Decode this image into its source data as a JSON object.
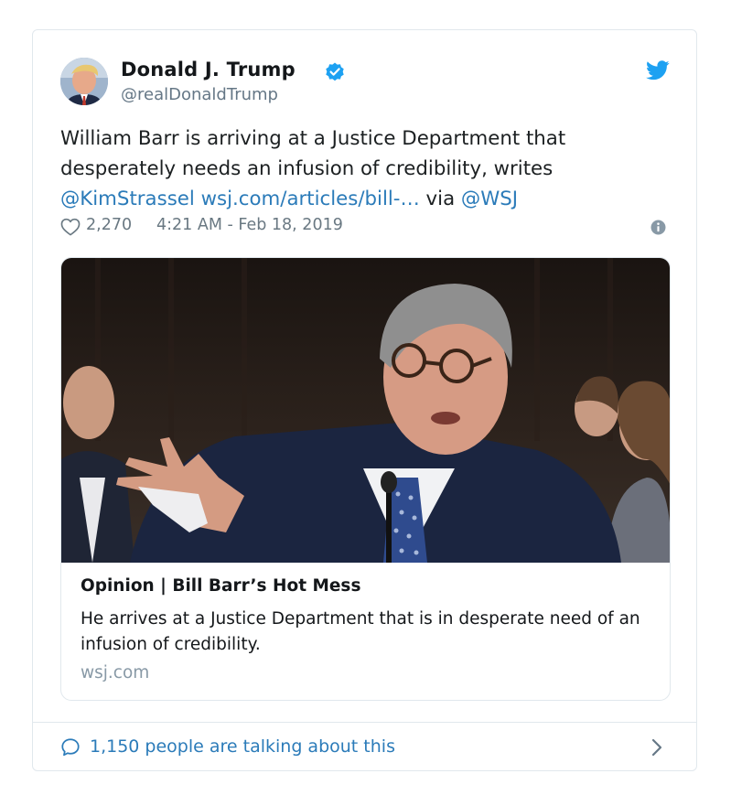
{
  "tweet": {
    "display_name": "Donald J. Trump",
    "handle": "@realDonaldTrump",
    "verified": true,
    "text_plain_1": "William Barr is arriving at a Justice Department that desperately needs an infusion of credibility, writes ",
    "mention_1": "@KimStrassel",
    "link_text": "wsj.com/articles/bill-…",
    "text_plain_2": " via ",
    "mention_2": "@WSJ",
    "likes": "2,270",
    "timestamp": "4:21 AM - Feb 18, 2019"
  },
  "card": {
    "title": "Opinion | Bill Barr’s Hot Mess",
    "description": "He arrives at a Justice Department that is in desperate need of an infusion of credibility.",
    "domain": "wsj.com"
  },
  "footer": {
    "talking_text": "1,150 people are talking about this"
  },
  "icons": {
    "verified": "verified-badge-icon",
    "bird": "twitter-bird-icon",
    "heart": "heart-icon",
    "info": "info-icon",
    "comment": "comment-bubble-icon",
    "chevron": "chevron-right-icon"
  },
  "colors": {
    "link": "#2b7bb9",
    "twitter_blue": "#1da1f2",
    "secondary_text": "#697882",
    "border": "#e1e8ed"
  }
}
